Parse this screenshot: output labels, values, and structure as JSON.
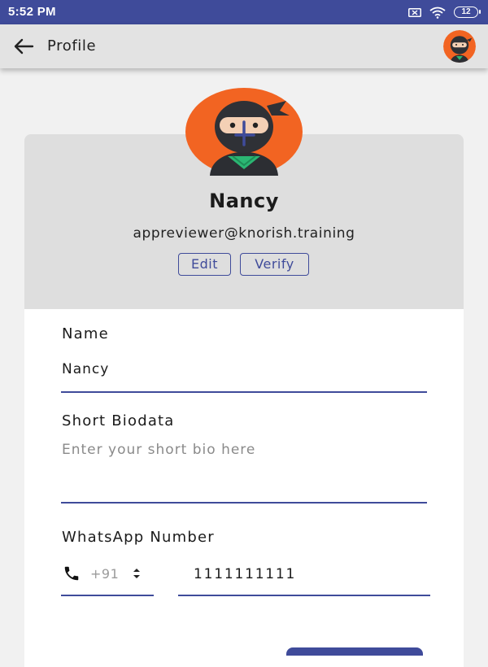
{
  "status_bar": {
    "time": "5:52 PM",
    "battery_level": "12",
    "icons": [
      "sim-icon",
      "wifi-icon",
      "battery-icon"
    ]
  },
  "app_bar": {
    "title": "Profile",
    "back_icon": "arrow-left-icon"
  },
  "profile": {
    "name": "Nancy",
    "email": "appreviewer@knorish.training",
    "edit_label": "Edit",
    "verify_label": "Verify"
  },
  "form": {
    "name": {
      "label": "Name",
      "value": "Nancy"
    },
    "bio": {
      "label": "Short Biodata",
      "value": "",
      "placeholder": "Enter your short bio here"
    },
    "whatsapp": {
      "label": "WhatsApp Number",
      "country_code": "+91",
      "number": "1111111111"
    }
  },
  "colors": {
    "primary": "#3f4b9a",
    "avatar_bg": "#f26422",
    "card_top": "#dedede",
    "background": "#f1f1f1"
  }
}
